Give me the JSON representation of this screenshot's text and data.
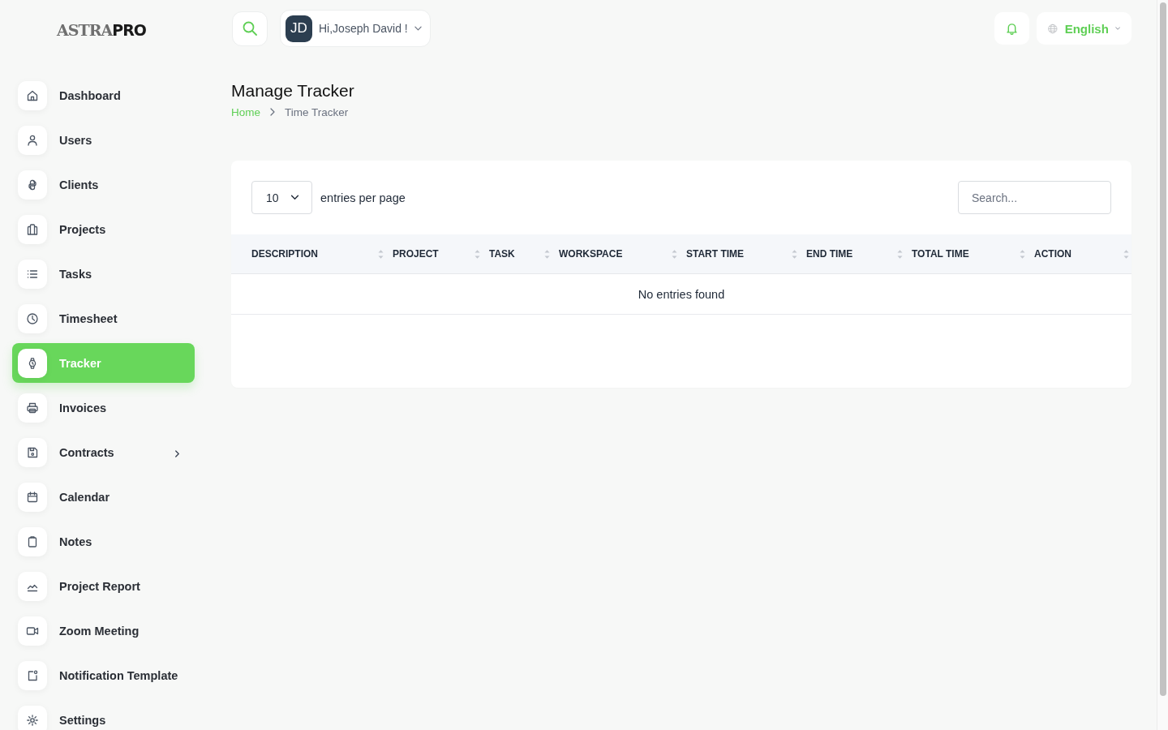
{
  "logo": {
    "text": "ASTRA**PRO**"
  },
  "sidebar": {
    "items": [
      {
        "label": "Dashboard",
        "selected": false,
        "submenu": false
      },
      {
        "label": "Users",
        "selected": false,
        "submenu": false
      },
      {
        "label": "Clients",
        "selected": false,
        "submenu": false
      },
      {
        "label": "Projects",
        "selected": false,
        "submenu": false
      },
      {
        "label": "Tasks",
        "selected": false,
        "submenu": false
      },
      {
        "label": "Timesheet",
        "selected": false,
        "submenu": false
      },
      {
        "label": "Tracker",
        "selected": true,
        "submenu": false
      },
      {
        "label": "Invoices",
        "selected": false,
        "submenu": false
      },
      {
        "label": "Contracts",
        "selected": false,
        "submenu": true
      },
      {
        "label": "Calendar",
        "selected": false,
        "submenu": false
      },
      {
        "label": "Notes",
        "selected": false,
        "submenu": false
      },
      {
        "label": "Project Report",
        "selected": false,
        "submenu": false
      },
      {
        "label": "Zoom Meeting",
        "selected": false,
        "submenu": false
      },
      {
        "label": "Notification Template",
        "selected": false,
        "submenu": false
      },
      {
        "label": "Settings",
        "selected": false,
        "submenu": false
      }
    ]
  },
  "header": {
    "user": {
      "initials": "JD",
      "greeting": "Hi,Joseph David !"
    },
    "language": {
      "label": "English"
    }
  },
  "page": {
    "title": "Manage Tracker",
    "breadcrumb": [
      {
        "label": "Home",
        "link": true
      },
      {
        "label": "Time Tracker",
        "link": false
      }
    ]
  },
  "table": {
    "page_size": "10",
    "page_size_label": "entries per page",
    "search": {
      "placeholder": "Search..."
    },
    "columns": [
      {
        "label": "DESCRIPTION",
        "sorted": false
      },
      {
        "label": "PROJECT",
        "sorted": false
      },
      {
        "label": "TASK",
        "sorted": false
      },
      {
        "label": "WORKSPACE",
        "sorted": false
      },
      {
        "label": "START TIME",
        "sorted": false
      },
      {
        "label": "END TIME",
        "sorted": false
      },
      {
        "label": "TOTAL TIME",
        "sorted": false
      },
      {
        "label": "ACTION",
        "sorted": false
      }
    ],
    "empty_message": "No entries found"
  }
}
